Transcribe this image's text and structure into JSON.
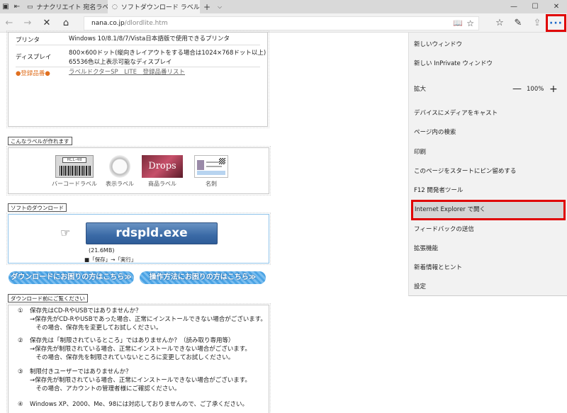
{
  "tabs": [
    {
      "title": "ナナクリエイト 宛名ラベル、表",
      "active": false
    },
    {
      "title": "ソフトダウンロード ラベルド",
      "active": true
    }
  ],
  "address": {
    "host": "nana.co.jp",
    "path": "/dlordlite.htm"
  },
  "spec": {
    "printer_label": "プリンタ",
    "printer_value": "Windows 10/8.1/8/7/Vista日本語版で使用できるプリンタ",
    "display_label": "ディスプレイ",
    "display_value_1": "800×600ドット(縦向きレイアウトをする場合は1024×768ドット以上)",
    "display_value_2": "65536色以上表示可能なディスプレイ",
    "reg_label": "●登録品番●",
    "reg_link": "ラベルドクターSP　LITE　登録品番リスト"
  },
  "labels_section": {
    "title": "こんなラベルが作れます",
    "items": [
      "バーコードラベル",
      "表示ラベル",
      "商品ラベル",
      "名刺"
    ],
    "barcode_text": "RCL-48",
    "drops_text": "Drops"
  },
  "download_section": {
    "title": "ソフトのダウンロード",
    "button": "rdspld.exe",
    "size": "(21.6MB)",
    "hint": "■「保存」→「実行」",
    "help1": "ダウンロードにお困りの方はこちら≫",
    "help2": "操作方法にお困りの方はこちら≫"
  },
  "notes_section": {
    "title": "ダウンロード前にご覧ください",
    "notes": [
      {
        "num": "①",
        "l1": "保存先はCD-RやUSBではありませんか？",
        "l2": "→保存先がCD-RやUSBであった場合、正常にインストールできない場合がございます。",
        "l3": "　その場合、保存先を変更してお試しください。"
      },
      {
        "num": "②",
        "l1": "保存先は「制限されているところ」ではありませんか？（読み取り専用等）",
        "l2": "→保存先が制限されている場合、正常にインストールできない場合がございます。",
        "l3": "　その場合、保存先を制限されていないところに変更してお試しください。"
      },
      {
        "num": "③",
        "l1": "制限付きユーザーではありませんか？",
        "l2": "→保存先が制限されている場合、正常にインストールできない場合がございます。",
        "l3": "　その場合、アカウントの管理者様にご確認ください。"
      },
      {
        "num": "④",
        "l1": "Windows XP、2000、Me、98には対応しておりませんので、ご了承ください。",
        "l2": "",
        "l3": ""
      }
    ]
  },
  "menu": {
    "new_window": "新しいウィンドウ",
    "new_private": "新しい InPrivate ウィンドウ",
    "zoom_label": "拡大",
    "zoom_minus": "—",
    "zoom_value": "100%",
    "zoom_plus": "+",
    "cast": "デバイスにメディアをキャスト",
    "find": "ページ内の検索",
    "print": "印刷",
    "pin": "このページをスタートにピン留めする",
    "devtools": "F12 開発者ツール",
    "open_ie": "Internet Explorer で開く",
    "feedback": "フィードバックの送信",
    "extensions": "拡張機能",
    "whatsnew": "新着情報とヒント",
    "settings": "設定"
  },
  "colors": {
    "highlight": "#e00000",
    "accent": "#1a66c9"
  }
}
